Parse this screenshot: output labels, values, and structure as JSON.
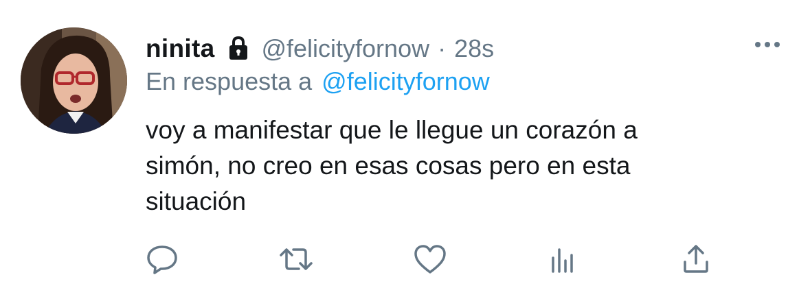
{
  "tweet": {
    "display_name": "ninita",
    "handle": "@felicityfornow",
    "separator": "·",
    "time": "28s",
    "reply_prefix": "En respuesta a",
    "reply_to": "@felicityfornow",
    "text": "voy a manifestar que le llegue un corazón a\nsimón, no creo en esas cosas pero en esta\nsituación",
    "protected": true
  },
  "icons": {
    "lock": "lock-icon",
    "more": "more-horizontal-icon",
    "reply": "reply-bubble-icon",
    "retweet": "retweet-icon",
    "like": "heart-icon",
    "stats": "analytics-icon",
    "share": "share-icon"
  },
  "colors": {
    "text": "#14171a",
    "secondary": "#657786",
    "link": "#1da1f2",
    "icon": "#657786"
  }
}
